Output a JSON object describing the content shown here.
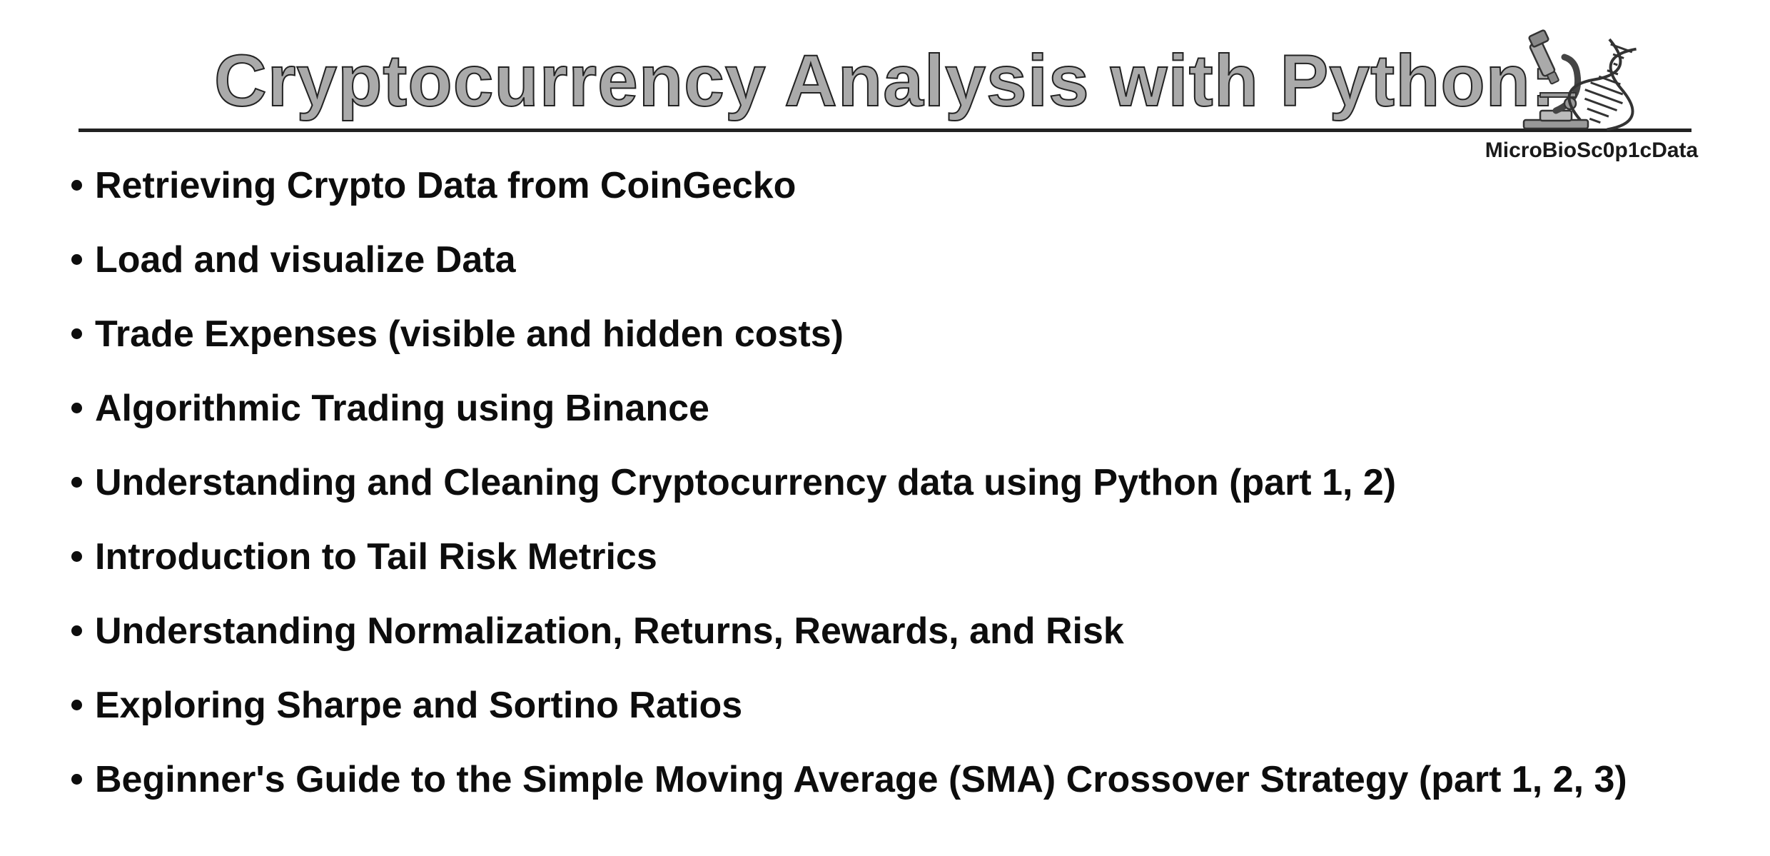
{
  "title": "Cryptocurrency Analysis with Python:",
  "brand": "MicroBioSc0p1cData",
  "bullets": [
    "Retrieving Crypto Data from CoinGecko",
    "Load and visualize Data",
    "Trade Expenses (visible and hidden costs)",
    "Algorithmic Trading using Binance",
    "Understanding and Cleaning Cryptocurrency data using Python (part 1, 2)",
    "Introduction to Tail Risk Metrics",
    "Understanding Normalization, Returns, Rewards, and Risk",
    "Exploring Sharpe and Sortino Ratios",
    "Beginner's Guide to the Simple Moving Average (SMA) Crossover Strategy (part 1, 2, 3)"
  ]
}
